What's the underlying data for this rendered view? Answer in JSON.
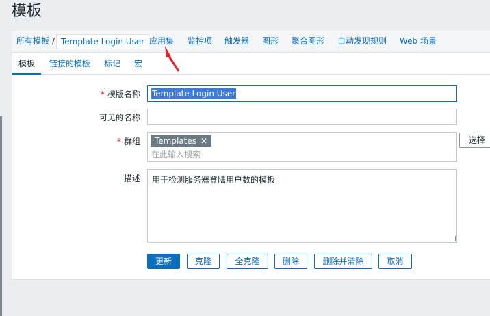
{
  "page": {
    "title": "模板"
  },
  "nav": {
    "all_templates": "所有模板",
    "separator": "/",
    "current_template": "Template Login User",
    "items": [
      "应用集",
      "监控项",
      "触发器",
      "图形",
      "聚合图形",
      "自动发现规则",
      "Web 场景"
    ]
  },
  "tabs": [
    "模板",
    "链接的模板",
    "标记",
    "宏"
  ],
  "form": {
    "template_name_label": "模版名称",
    "template_name_value": "Template Login User",
    "required_mark": "*",
    "visible_name_label": "可见的名称",
    "visible_name_value": "",
    "groups_label": "群组",
    "group_chip": "Templates",
    "group_chip_remove": "✕",
    "groups_search_placeholder": "在此输入搜索",
    "choose_button": "选择",
    "description_label": "描述",
    "description_value": "用于检测服务器登陆用户数的模板"
  },
  "buttons": {
    "update": "更新",
    "clone": "克隆",
    "full_clone": "全克隆",
    "delete": "删除",
    "delete_and_clear": "删除并清除",
    "cancel": "取消"
  },
  "colors": {
    "accent": "#0a6dbd",
    "required": "#d40000",
    "annotation_arrow": "#e8202a"
  }
}
